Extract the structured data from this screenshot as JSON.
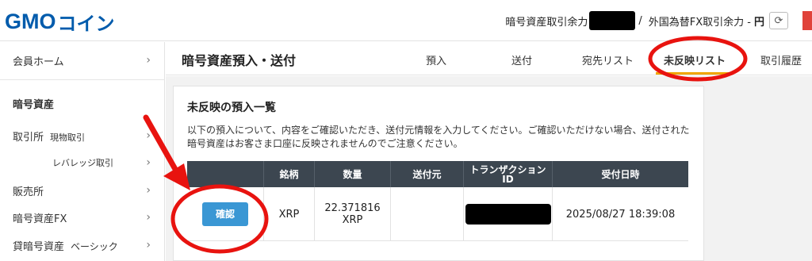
{
  "header": {
    "logo_gmo": "GMO",
    "logo_coin": "コイン",
    "crypto_balance_label": "暗号資産取引余力",
    "separator": "/",
    "fx_balance_label": "外国為替FX取引余力 -",
    "fx_unit": "円",
    "refresh_glyph": "⟳"
  },
  "sidebar": {
    "member_home": "会員ホーム",
    "crypto_heading": "暗号資産",
    "exchange": "取引所",
    "exchange_spot": "現物取引",
    "exchange_leverage": "レバレッジ取引",
    "sales": "販売所",
    "crypto_fx": "暗号資産FX",
    "lending": "貸暗号資産",
    "lending_basic": "ベーシック",
    "chevron": "›"
  },
  "titlebar": {
    "title": "暗号資産預入・送付",
    "tabs": [
      {
        "label": "預入"
      },
      {
        "label": "送付"
      },
      {
        "label": "宛先リスト"
      },
      {
        "label": "未反映リスト"
      },
      {
        "label": "取引履歴"
      }
    ],
    "active_tab": "未反映リスト"
  },
  "card": {
    "title": "未反映の預入一覧",
    "description": "以下の預入について、内容をご確認いただき、送付元情報を入力してください。ご確認いただけない場合、送付された暗号資産はお客さま口座に反映されませんのでご注意ください。"
  },
  "table": {
    "headers": {
      "blank": "",
      "symbol": "銘柄",
      "amount": "数量",
      "sender": "送付元",
      "txid_line1": "トランザクション",
      "txid_line2": "ID",
      "received_at": "受付日時"
    },
    "row": {
      "button": "確認",
      "symbol": "XRP",
      "amount_value": "22.371816",
      "amount_unit": "XRP",
      "sender": "",
      "received_at": "2025/08/27 18:39:08"
    }
  },
  "colors": {
    "brand_blue": "#005bac",
    "tab_underline": "#f0a500",
    "table_header": "#3c4650",
    "confirm_button": "#3a97d4",
    "annotation_red": "#e8130f"
  }
}
